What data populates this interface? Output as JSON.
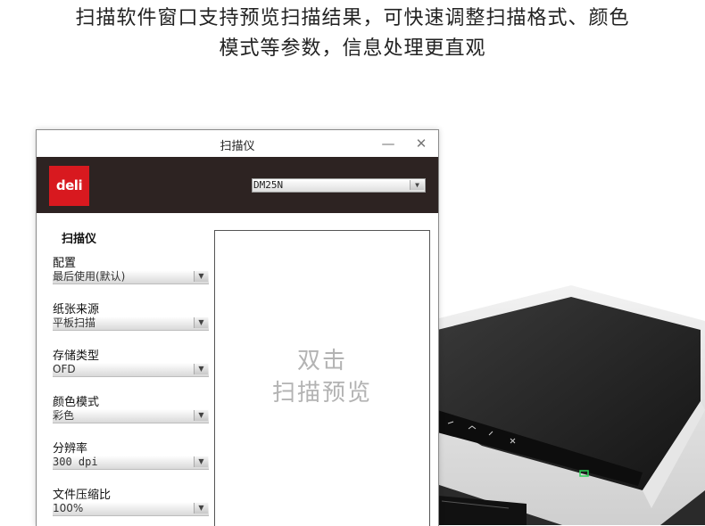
{
  "headline": {
    "line1": "扫描软件窗口支持预览扫描结果，可快速调整扫描格式、颜色",
    "line2": "模式等参数，信息处理更直观"
  },
  "window": {
    "title": "扫描仪",
    "minimize_glyph": "—",
    "close_glyph": "✕",
    "brand_logo_text": "deli",
    "device_select": {
      "value": "DM25N"
    },
    "panel_title": "扫描仪",
    "fields": [
      {
        "label": "配置",
        "value": "最后使用(默认)"
      },
      {
        "label": "纸张来源",
        "value": "平板扫描"
      },
      {
        "label": "存储类型",
        "value": "OFD"
      },
      {
        "label": "颜色模式",
        "value": "彩色"
      },
      {
        "label": "分辨率",
        "value": "300 dpi"
      },
      {
        "label": "文件压缩比",
        "value": "100%"
      }
    ],
    "dropdown_arrow": "▼",
    "preview": {
      "line1": "双击",
      "line2": "扫描预览"
    }
  },
  "colors": {
    "brand_red": "#d8191f",
    "header_band": "#2d2322",
    "preview_text": "#b3b3b3"
  },
  "icons": [
    "minimize-icon",
    "close-icon",
    "chevron-down-icon",
    "deli-logo"
  ]
}
